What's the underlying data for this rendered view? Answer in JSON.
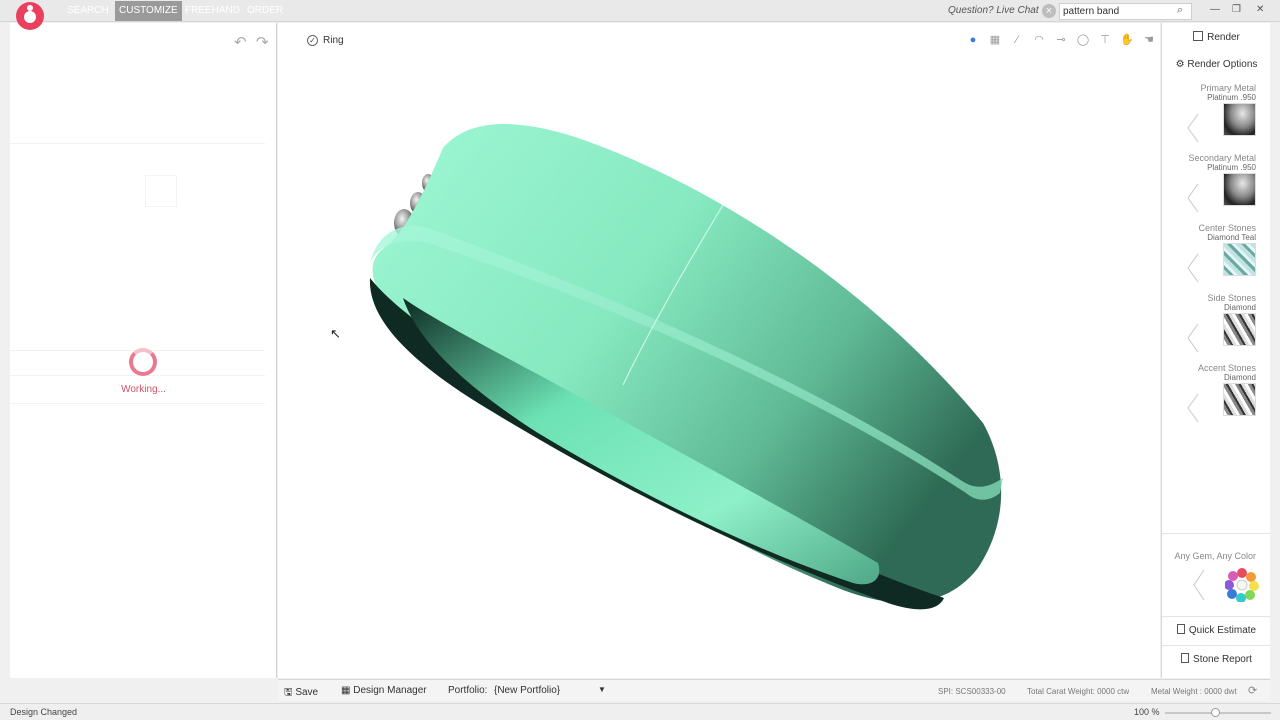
{
  "nav": {
    "tabs": [
      {
        "label": "SEARCH"
      },
      {
        "label": "CUSTOMIZE"
      },
      {
        "label": "FREEHAND"
      },
      {
        "label": "ORDER"
      }
    ],
    "active": "CUSTOMIZE",
    "live_chat": "Question? Live Chat",
    "search_value": "pattern band",
    "accent": "#e94060"
  },
  "left_panel": {
    "working": "Working..."
  },
  "viewport": {
    "label": "Ring",
    "ring_color": "#8ef0c8"
  },
  "right_panel": {
    "render": "Render",
    "render_options": "Render Options",
    "materials": [
      {
        "title": "Primary Metal",
        "value": "Platinum .950",
        "swatch": "metal"
      },
      {
        "title": "Secondary Metal",
        "value": "Platinum .950",
        "swatch": "metal"
      },
      {
        "title": "Center Stones",
        "value": "Diamond Teal",
        "swatch": "gem-teal"
      },
      {
        "title": "Side Stones",
        "value": "Diamond",
        "swatch": "gem-diamond"
      },
      {
        "title": "Accent Stones",
        "value": "Diamond",
        "swatch": "gem-diamond"
      }
    ],
    "any_gem": "Any Gem, Any Color",
    "quick_estimate": "Quick Estimate",
    "stone_report": "Stone Report"
  },
  "bottom": {
    "save": "Save",
    "design_manager": "Design Manager",
    "portfolio_label": "Portfolio:",
    "portfolio_value": "{New Portfolio}",
    "spi": "SPI:   SCS00333-00",
    "total_carat_weight": "Total Carat Weight:  0000 ctw",
    "metal_weight": "Metal Weight :  0000 dwt"
  },
  "status": {
    "text": "Design Changed",
    "zoom": "100 %",
    "zoom_fraction": 0.47
  }
}
